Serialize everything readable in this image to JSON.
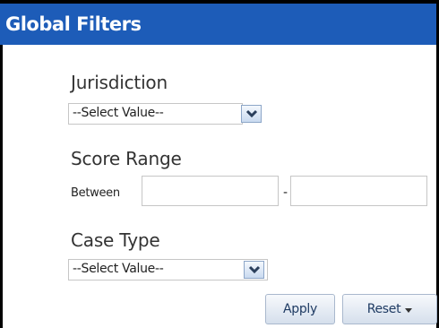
{
  "panel": {
    "title": "Global Filters"
  },
  "filters": {
    "jurisdiction": {
      "label": "Jurisdiction",
      "selected": "--Select Value--"
    },
    "score_range": {
      "label": "Score Range",
      "between_label": "Between",
      "separator": "-",
      "min_value": "",
      "max_value": ""
    },
    "case_type": {
      "label": "Case Type",
      "selected": "--Select Value--"
    }
  },
  "actions": {
    "apply_label": "Apply",
    "reset_label": "Reset"
  },
  "colors": {
    "header_bg": "#1d5cb8",
    "header_text": "#ffffff"
  }
}
